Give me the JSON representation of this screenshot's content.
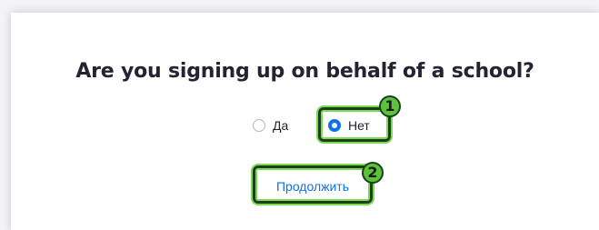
{
  "question": "Are you signing up on behalf of a school?",
  "options": [
    {
      "label": "Да",
      "selected": false
    },
    {
      "label": "Нет",
      "selected": true
    }
  ],
  "continue_label": "Продолжить",
  "annotations": {
    "step1": "1",
    "step2": "2"
  },
  "colors": {
    "accent": "#0e72ed",
    "highlight_green": "#5cc23a",
    "highlight_border": "#1c3f1c"
  }
}
